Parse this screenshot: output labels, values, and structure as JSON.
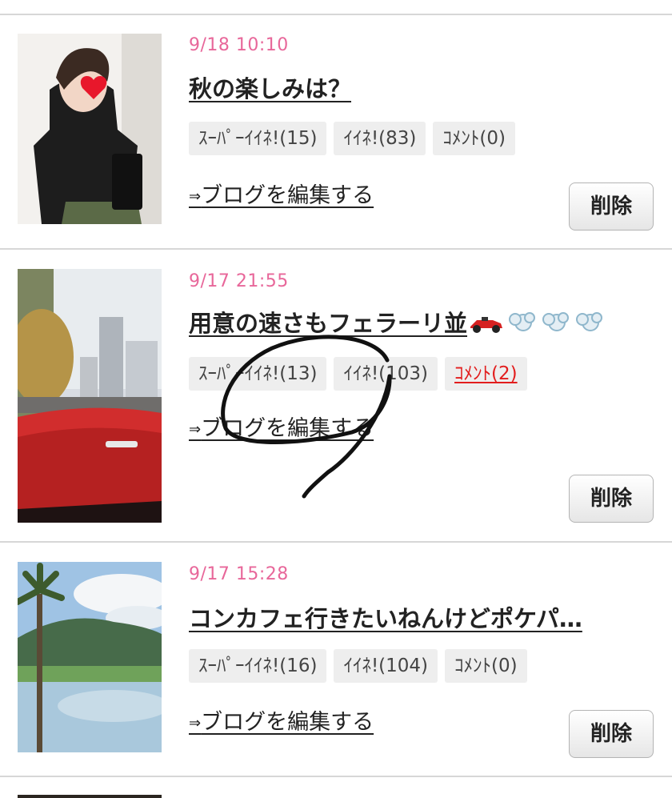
{
  "posts": [
    {
      "date": "9/18 10:10",
      "title": "秋の楽しみは？",
      "badges": [
        "ｽｰﾊﾟｰｲｲﾈ!(15)",
        "ｲｲﾈ!(83)",
        "ｺﾒﾝﾄ(0)"
      ],
      "edit_label": "ブログを編集する",
      "delete_label": "削除"
    },
    {
      "date": "9/17 21:55",
      "title": "用意の速さもフェラーリ並",
      "title_emojis": [
        "racing-car-icon",
        "dash-icon",
        "dash-icon",
        "dash-icon"
      ],
      "badges": [
        "ｽｰﾊﾟｰｲｲﾈ!(13)",
        "ｲｲﾈ!(103)",
        "ｺﾒﾝﾄ(2)"
      ],
      "edit_label": "ブログを編集する",
      "delete_label": "削除"
    },
    {
      "date": "9/17 15:28",
      "title": "コンカフェ行きたいねんけどポケパ…",
      "badges": [
        "ｽｰﾊﾟｰｲｲﾈ!(16)",
        "ｲｲﾈ!(104)",
        "ｺﾒﾝﾄ(0)"
      ],
      "edit_label": "ブログを編集する",
      "delete_label": "削除"
    }
  ],
  "edit_arrow": "⇒",
  "colors": {
    "date": "#e8679a",
    "comment_active": "#e21d1d",
    "badge_bg": "#eeeeee"
  }
}
